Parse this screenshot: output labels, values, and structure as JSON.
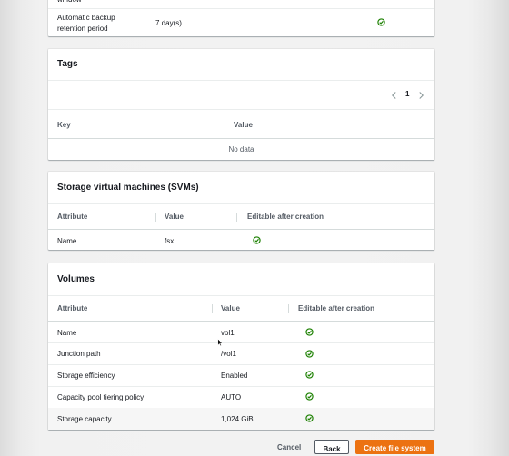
{
  "top_card": {
    "cut_text": "window",
    "row": {
      "label_line1": "Automatic backup",
      "label_line2": "retention period",
      "value": "7 day(s)",
      "editable_icon": "check-circle-icon"
    }
  },
  "tags": {
    "title": "Tags",
    "pagination": {
      "prev_icon": "chevron-left-icon",
      "page": "1",
      "next_icon": "chevron-right-icon"
    },
    "columns": [
      "Key",
      "Value"
    ],
    "empty_text": "No data"
  },
  "svms": {
    "title": "Storage virtual machines (SVMs)",
    "columns": [
      "Attribute",
      "Value",
      "Editable after creation"
    ],
    "rows": [
      {
        "attribute": "Name",
        "value": "fsx"
      }
    ]
  },
  "volumes": {
    "title": "Volumes",
    "columns": [
      "Attribute",
      "Value",
      "Editable after creation"
    ],
    "rows": [
      {
        "attribute": "Name",
        "value": "vol1"
      },
      {
        "attribute": "Junction path",
        "value": "/vol1"
      },
      {
        "attribute": "Storage efficiency",
        "value": "Enabled"
      },
      {
        "attribute": "Capacity pool tiering policy",
        "value": "AUTO"
      },
      {
        "attribute": "Storage capacity",
        "value": "1,024 GiB"
      }
    ]
  },
  "footer": {
    "cancel": "Cancel",
    "back": "Back",
    "create": "Create file system"
  },
  "colors": {
    "check": "#1d8102",
    "primary": "#ec7211",
    "header_text": "#545b64"
  }
}
